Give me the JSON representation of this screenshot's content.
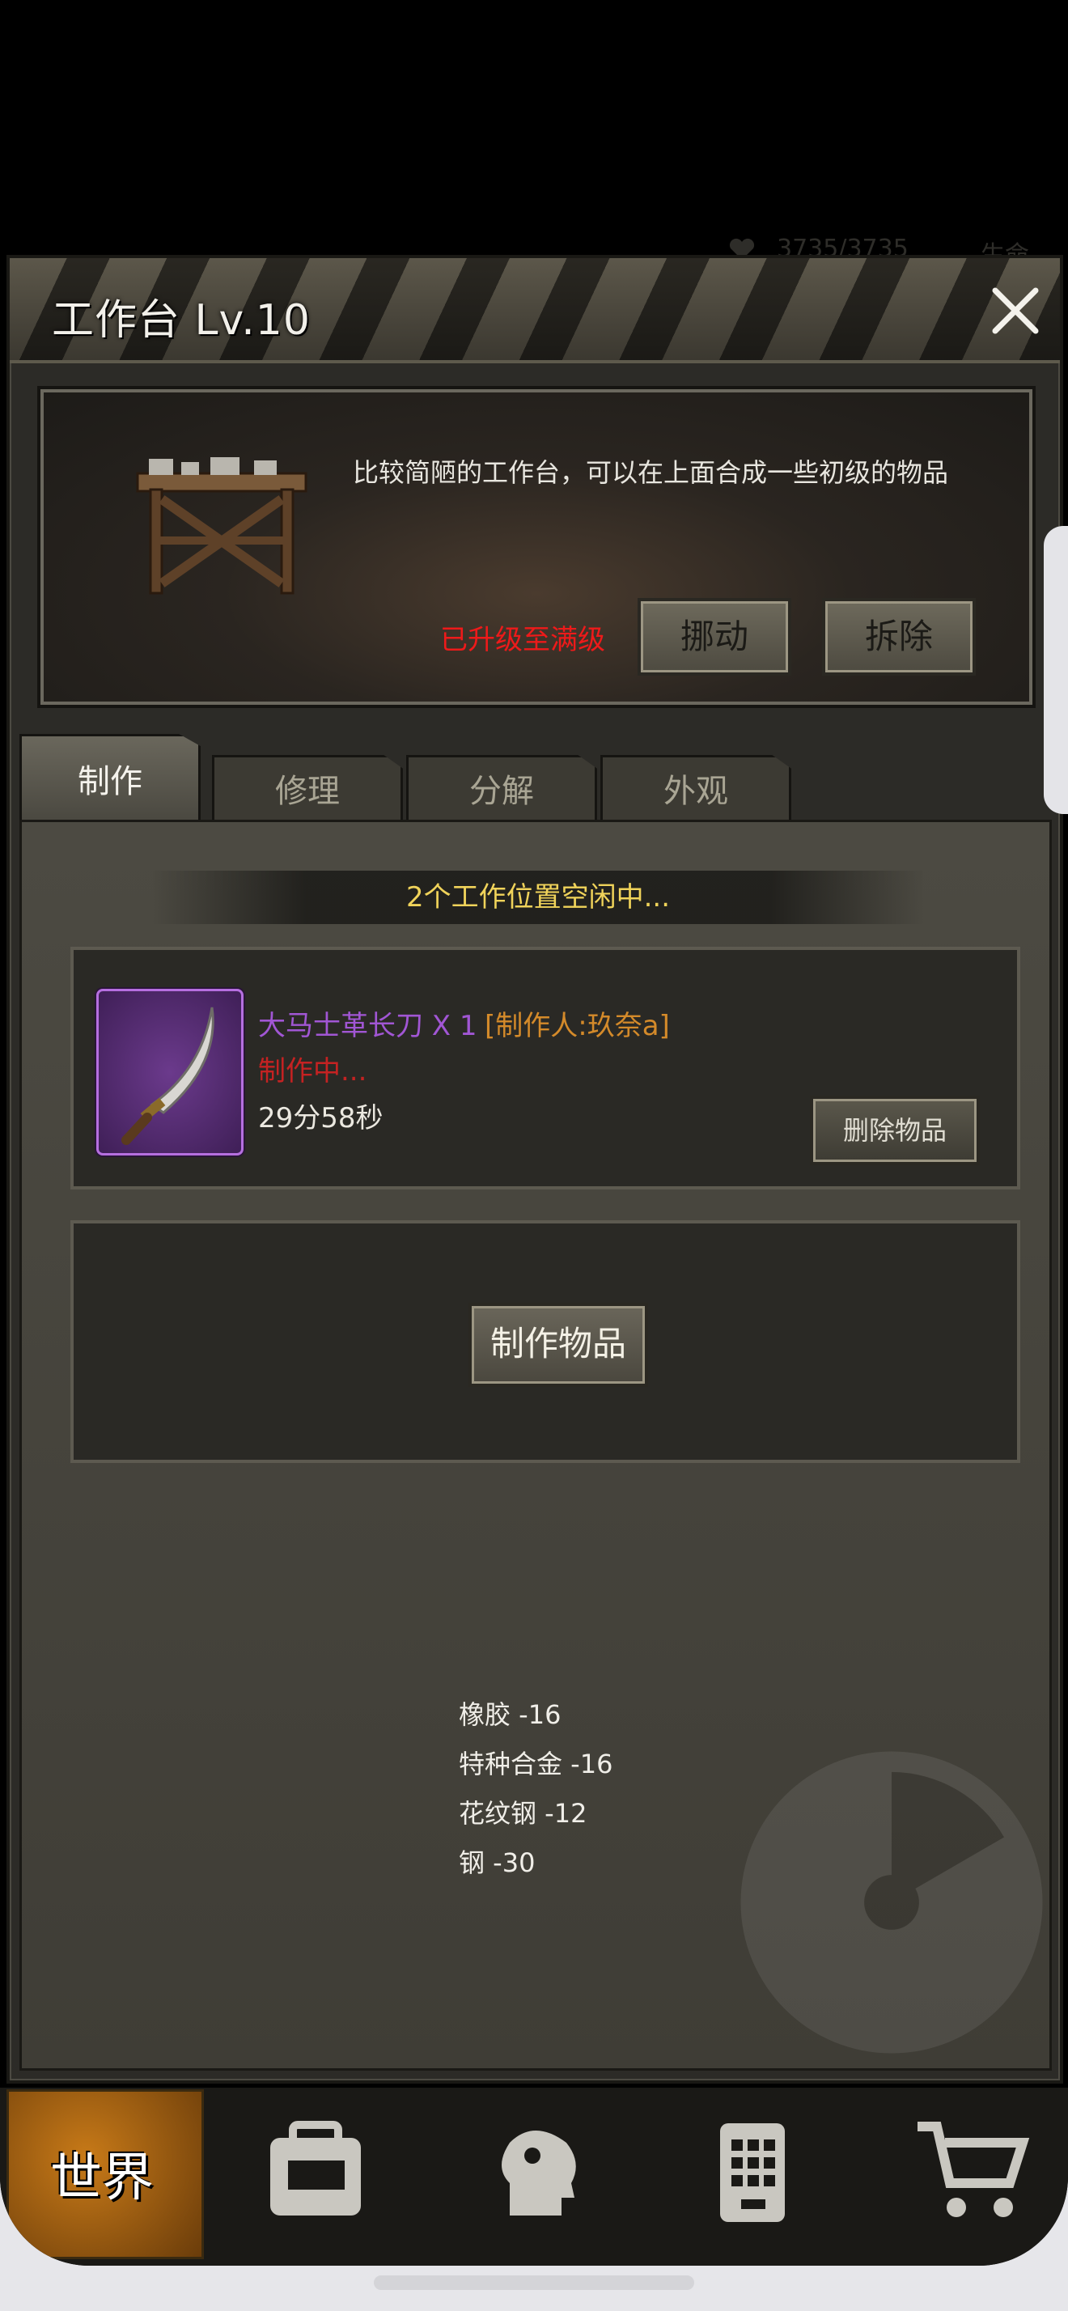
{
  "background_status": {
    "hp": "3735/3735",
    "life_label": "生命"
  },
  "dialog": {
    "title": "工作台 Lv.10",
    "info": {
      "description": "比较简陋的工作台，可以在上面合成一些初级的物品",
      "max_level_text": "已升级至满级",
      "move_label": "挪动",
      "remove_label": "拆除"
    },
    "tabs": [
      {
        "label": "制作",
        "active": true
      },
      {
        "label": "修理",
        "active": false
      },
      {
        "label": "分解",
        "active": false
      },
      {
        "label": "外观",
        "active": false
      }
    ],
    "craft": {
      "slots_status": "2个工作位置空闲中...",
      "in_progress": {
        "item_name": "大马士革长刀 X 1",
        "maker": "[制作人:玖奈a]",
        "status": "制作中...",
        "timer": "29分58秒",
        "delete_label": "删除物品"
      },
      "make_label": "制作物品",
      "materials": [
        "橡胶 -16",
        "特种合金 -16",
        "花纹钢 -12",
        "钢 -30"
      ]
    }
  },
  "bottom_nav": {
    "world_label": "世界",
    "items": [
      "backpack-icon",
      "skills-icon",
      "phone-icon",
      "shop-cart-icon"
    ]
  },
  "colors": {
    "accent_gold": "#f0d35a",
    "item_purple": "#a156d4",
    "maker_orange": "#d48a2a",
    "warning_red": "#ee1a1a"
  }
}
